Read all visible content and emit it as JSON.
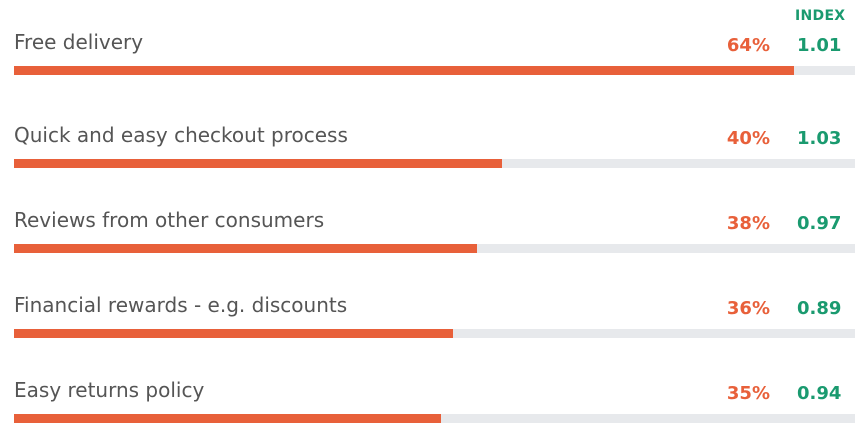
{
  "chart_data": {
    "type": "bar",
    "orientation": "horizontal",
    "index_header": "INDEX",
    "categories": [
      "Free delivery",
      "Quick and easy checkout process",
      "Reviews from other consumers",
      "Financial rewards - e.g. discounts",
      "Easy returns policy"
    ],
    "values": [
      64,
      40,
      38,
      36,
      35
    ],
    "value_labels": [
      "64%",
      "40%",
      "38%",
      "36%",
      "35%"
    ],
    "index_labels": [
      "1.01",
      "1.03",
      "0.97",
      "0.89",
      "0.94"
    ],
    "xlim": [
      0,
      69
    ],
    "colors": {
      "bar": "#e8603a",
      "track": "#e7e9ec",
      "percent": "#e8603a",
      "index": "#1a9a6f"
    }
  }
}
